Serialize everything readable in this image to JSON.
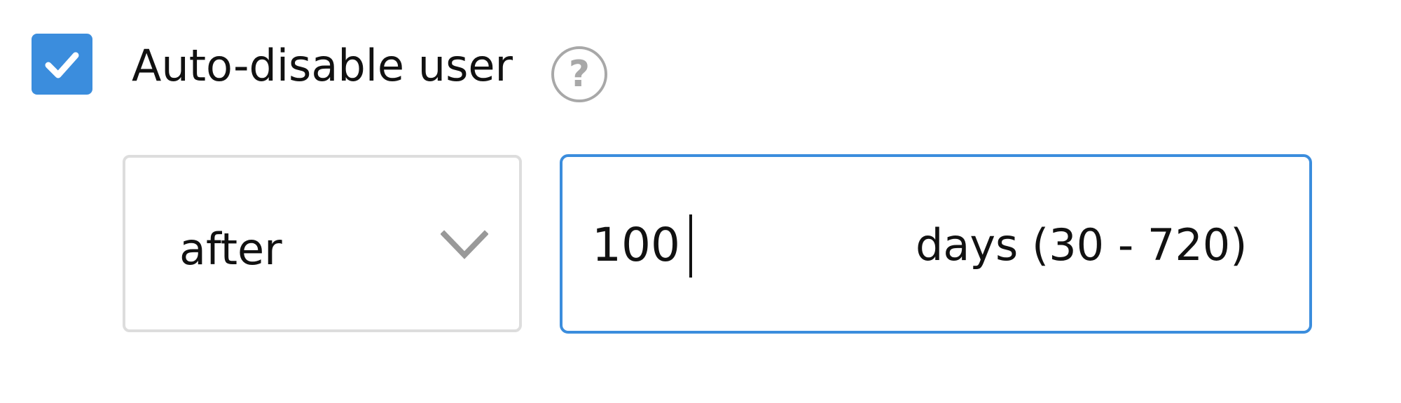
{
  "setting": {
    "checked": true,
    "label": "Auto-disable user",
    "help_icon": "help-circle-icon",
    "help_symbol": "?"
  },
  "timing": {
    "select": {
      "selected": "after",
      "icon": "chevron-down-icon"
    },
    "days": {
      "value": "100",
      "unit_label": "days (30 - 720)"
    }
  },
  "colors": {
    "accent": "#3b8ddd",
    "border": "#dddddd",
    "help_icon": "#a8a8a8",
    "text": "#111111"
  }
}
